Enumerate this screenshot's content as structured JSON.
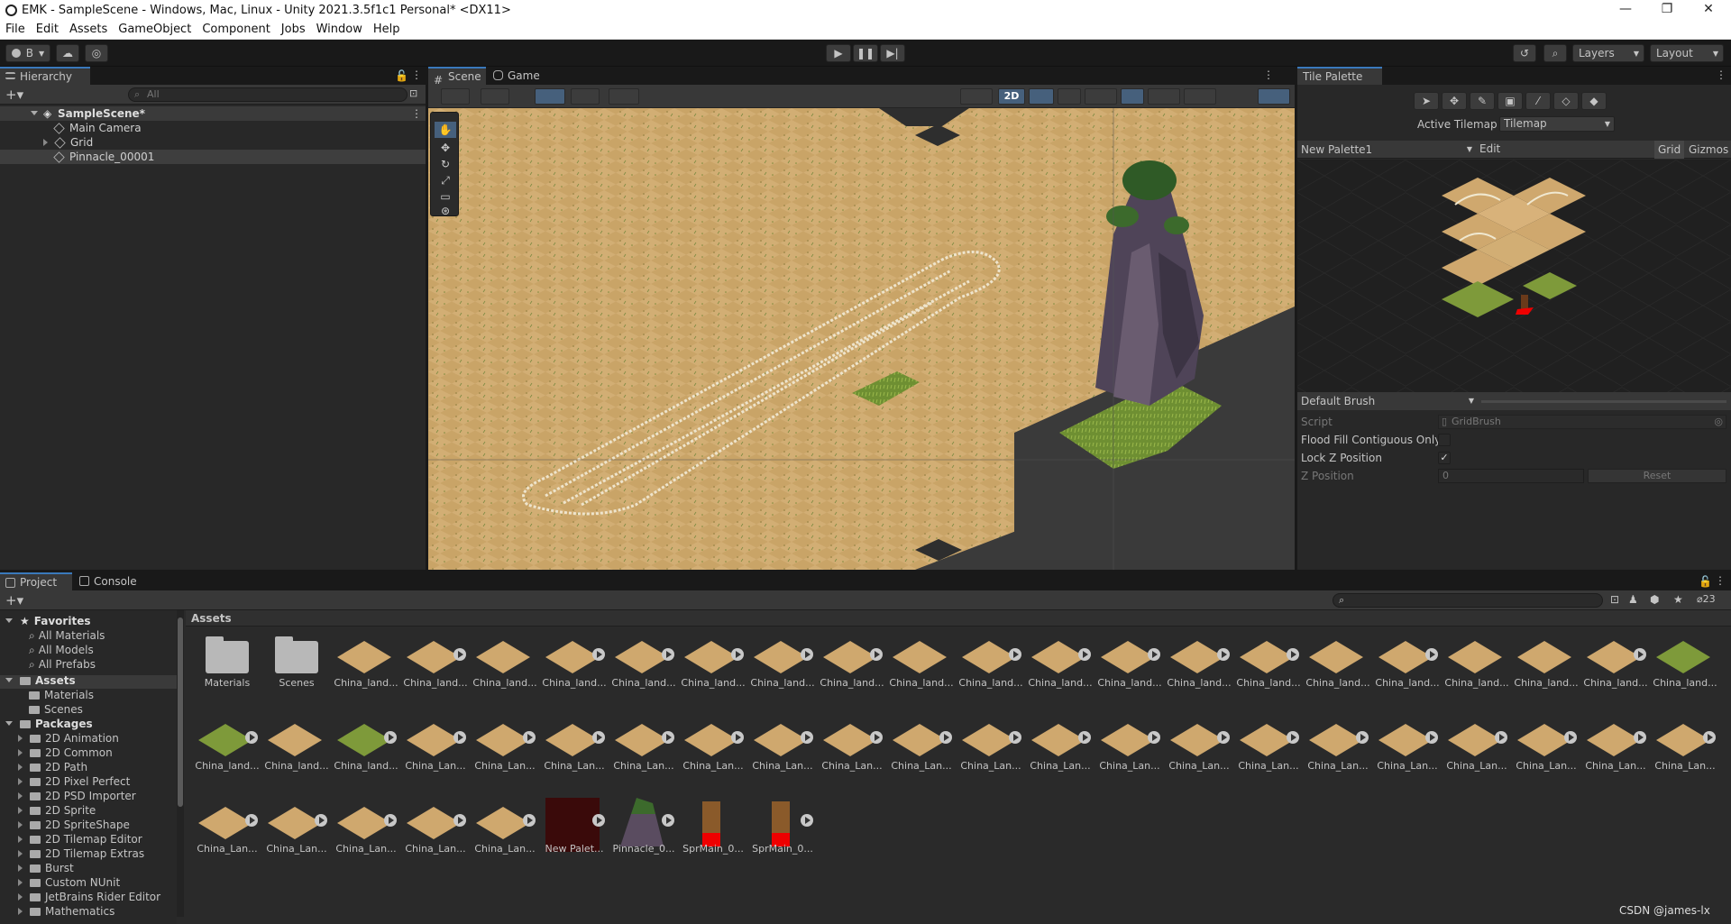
{
  "window": {
    "title": "EMK - SampleScene - Windows, Mac, Linux - Unity 2021.3.5f1c1 Personal* <DX11>",
    "minimize": "—",
    "maximize": "❐",
    "close": "✕"
  },
  "menu": [
    "File",
    "Edit",
    "Assets",
    "GameObject",
    "Component",
    "Jobs",
    "Window",
    "Help"
  ],
  "toolbar": {
    "account": "B",
    "layers": "Layers",
    "layout": "Layout"
  },
  "hierarchy": {
    "tab": "Hierarchy",
    "search_placeholder": "All",
    "scene": "SampleScene*",
    "items": [
      "Main Camera",
      "Grid",
      "Pinnacle_00001"
    ]
  },
  "scene_tabs": {
    "scene": "Scene",
    "game": "Game",
    "mode2d": "2D"
  },
  "tile_palette": {
    "tab": "Tile Palette",
    "active_tilemap_label": "Active Tilemap",
    "active_tilemap_value": "Tilemap",
    "palette": "New Palette1",
    "edit": "Edit",
    "grid": "Grid",
    "gizmos": "Gizmos",
    "brush": "Default Brush",
    "script_label": "Script",
    "script_value": "GridBrush",
    "flood_label": "Flood Fill Contiguous Only",
    "lockz_label": "Lock Z Position",
    "zpos_label": "Z Position",
    "zpos_value": "0",
    "reset": "Reset"
  },
  "bottom_tabs": {
    "project": "Project",
    "console": "Console",
    "count": "23"
  },
  "project_tree": {
    "favorites": "Favorites",
    "fav_items": [
      "All Materials",
      "All Models",
      "All Prefabs"
    ],
    "assets": "Assets",
    "asset_items": [
      "Materials",
      "Scenes"
    ],
    "packages": "Packages",
    "package_items": [
      "2D Animation",
      "2D Common",
      "2D Path",
      "2D Pixel Perfect",
      "2D PSD Importer",
      "2D Sprite",
      "2D SpriteShape",
      "2D Tilemap Editor",
      "2D Tilemap Extras",
      "Burst",
      "Custom NUnit",
      "JetBrains Rider Editor",
      "Mathematics"
    ]
  },
  "assets_header": "Assets",
  "assets_row1": [
    "Materials",
    "Scenes",
    "China_land...",
    "China_land...",
    "China_land...",
    "China_land...",
    "China_land...",
    "China_land...",
    "China_land...",
    "China_land...",
    "China_land...",
    "China_land...",
    "China_land...",
    "China_land...",
    "China_land...",
    "China_land...",
    "China_land...",
    "China_land...",
    "China_land...",
    "China_land...",
    "China_land...",
    "China_land..."
  ],
  "assets_row2": [
    "China_land...",
    "China_land...",
    "China_land...",
    "China_Lan...",
    "China_Lan...",
    "China_Lan...",
    "China_Lan...",
    "China_Lan...",
    "China_Lan...",
    "China_Lan...",
    "China_Lan...",
    "China_Lan...",
    "China_Lan...",
    "China_Lan...",
    "China_Lan...",
    "China_Lan...",
    "China_Lan...",
    "China_Lan...",
    "China_Lan...",
    "China_Lan...",
    "China_Lan...",
    "China_Lan..."
  ],
  "assets_row3": [
    "China_Lan...",
    "China_Lan...",
    "China_Lan...",
    "China_Lan...",
    "China_Lan...",
    "New Palet...",
    "Pinnacle_0...",
    "SprMain_0...",
    "SprMain_0..."
  ],
  "watermark": "CSDN @james-lx"
}
